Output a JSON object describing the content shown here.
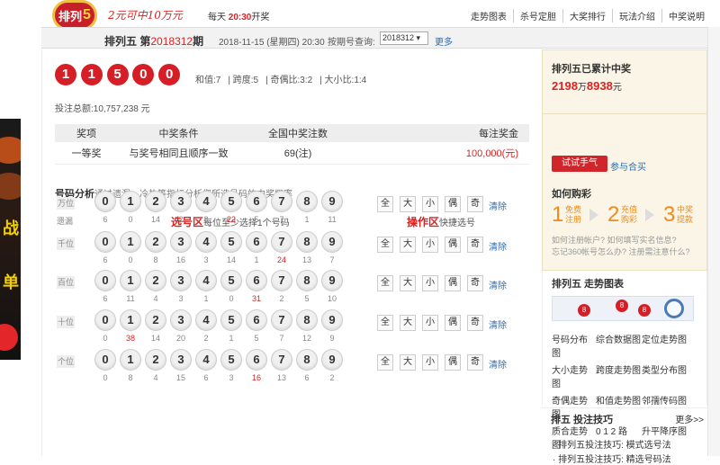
{
  "header": {
    "logo_text": "排列",
    "logo_num": "5",
    "slogan": "2元可中10万元",
    "daily_prefix": "每天",
    "daily_time": "20:30",
    "daily_suffix": "开奖",
    "nav": [
      "走势图表",
      "杀号定胆",
      "大奖排行",
      "玩法介绍",
      "中奖说明"
    ]
  },
  "issue": {
    "game": "排列五",
    "prefix": "第",
    "number": "2018312",
    "suffix": "期",
    "date": "2018-11-15 (星期四) 20:30",
    "query_label": "按期号查询:",
    "selected_issue": "2018312",
    "more": "更多"
  },
  "draw": {
    "balls": [
      "1",
      "1",
      "5",
      "0",
      "0"
    ],
    "sum": "和值:7",
    "span": "跨度:5",
    "odd_even": "奇偶比:3:2",
    "big_small": "大小比:1:4",
    "total_bet": "投注总额:10,757,238 元"
  },
  "prize_table": {
    "headers": [
      "奖项",
      "中奖条件",
      "全国中奖注数",
      "每注奖金"
    ],
    "rows": [
      {
        "level": "一等奖",
        "condition": "与奖号相同且顺序一致",
        "count": "69(注)",
        "amount": "100,000(元)"
      }
    ]
  },
  "analysis": {
    "title": "号码分析",
    "desc": "通过遗漏、冷热等指标分析您所选号码的中奖概率"
  },
  "select_zone": {
    "title": "选号区",
    "hint": "每位至少选择1个号码"
  },
  "op_zone": {
    "title": "操作区",
    "hint": "快捷选号",
    "buttons": [
      "全",
      "大",
      "小",
      "偶",
      "奇"
    ],
    "clear": "清除"
  },
  "miss_label": "遗漏",
  "digits": [
    "0",
    "1",
    "2",
    "3",
    "4",
    "5",
    "6",
    "7",
    "8",
    "9"
  ],
  "rows": [
    {
      "label": "万位",
      "miss": [
        "6",
        "0",
        "14",
        "2",
        "8",
        "22",
        "5",
        "7",
        "1",
        "11"
      ],
      "hot": 5
    },
    {
      "label": "千位",
      "miss": [
        "6",
        "0",
        "8",
        "16",
        "3",
        "14",
        "1",
        "24",
        "13",
        "7"
      ],
      "hot": 7
    },
    {
      "label": "百位",
      "miss": [
        "6",
        "11",
        "4",
        "3",
        "1",
        "0",
        "31",
        "2",
        "5",
        "10"
      ],
      "hot": 6
    },
    {
      "label": "十位",
      "miss": [
        "0",
        "38",
        "14",
        "20",
        "2",
        "1",
        "5",
        "7",
        "12",
        "9"
      ],
      "hot": 1
    },
    {
      "label": "个位",
      "miss": [
        "0",
        "8",
        "4",
        "15",
        "6",
        "3",
        "16",
        "13",
        "6",
        "2"
      ],
      "hot": 6
    }
  ],
  "sidebar": {
    "jackpot_title": "排列五已累计中奖",
    "jackpot_wan": "2198",
    "jackpot_wan_unit": "万",
    "jackpot_rest": "8938",
    "jackpot_yuan_unit": "元",
    "bet_button": "试试手气",
    "recharge_link": "参与合买",
    "howto_title": "如何购彩",
    "steps": [
      {
        "n": "1",
        "t": "免费注册"
      },
      {
        "n": "2",
        "t": "充值购彩"
      },
      {
        "n": "3",
        "t": "中奖提款"
      }
    ],
    "faq1": "如何注册帐户? 如何填写实名信息?",
    "faq2": "忘记360帐号怎么办? 注册需注意什么?",
    "trend_title": "排列五 走势图表",
    "trend_links": [
      "号码分布图",
      "综合数据图",
      "定位走势图",
      "大小走势图",
      "跨度走势图",
      "类型分布图",
      "奇偶走势图",
      "和值走势图",
      "邻孺传码图",
      "质合走势图",
      "0 1 2 路",
      "升平降序图"
    ],
    "trend_balls": [
      "8",
      "8",
      "8"
    ],
    "tips_title": "排五 投注技巧",
    "tips_more": "更多>>",
    "tips_item": "· 排列五投注技巧: 模式选号法",
    "tips_item2": "· 排列五投注技巧: 精选号码法"
  },
  "colors": {
    "accent": "#d61e26",
    "link": "#2a6db5",
    "sidebar_bg": "#faf5e6"
  }
}
